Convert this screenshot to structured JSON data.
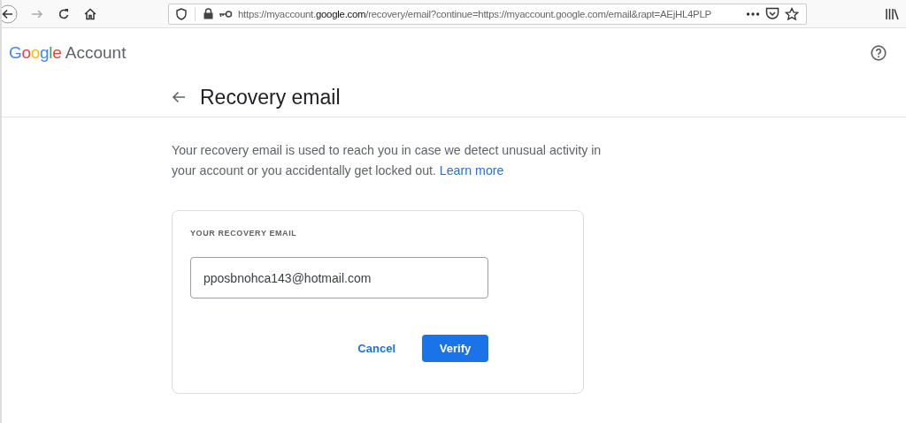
{
  "browser": {
    "url_parts": [
      {
        "text": "https://myaccount.",
        "kind": "dim"
      },
      {
        "text": "google.com",
        "kind": "host"
      },
      {
        "text": "/recovery/email?continue=https://myaccount.google.com/email&rapt=AEjHL4PLP",
        "kind": "dim"
      }
    ]
  },
  "header": {
    "logo_letters": [
      {
        "text": "G",
        "color": "#4285f4"
      },
      {
        "text": "o",
        "color": "#ea4335"
      },
      {
        "text": "o",
        "color": "#fbbc05"
      },
      {
        "text": "g",
        "color": "#4285f4"
      },
      {
        "text": "l",
        "color": "#34a853"
      },
      {
        "text": "e",
        "color": "#ea4335"
      }
    ],
    "product": "Account"
  },
  "page": {
    "title": "Recovery email",
    "description": "Your recovery email is used to reach you in case we detect unusual activity in your account or you accidentally get locked out.",
    "link": "Learn more"
  },
  "card": {
    "label": "YOUR RECOVERY EMAIL",
    "email": "pposbnohca143@hotmail.com",
    "buttons": [
      {
        "label": "Cancel",
        "kind": "text"
      },
      {
        "label": "Verify",
        "kind": "primary"
      }
    ]
  }
}
